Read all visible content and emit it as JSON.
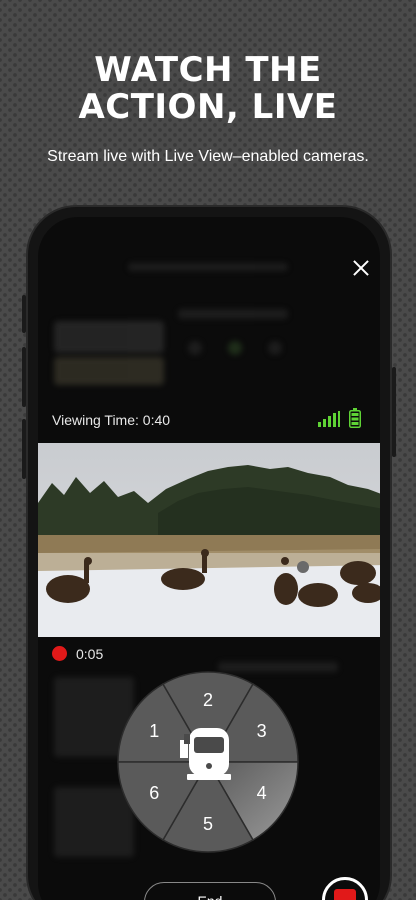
{
  "promo": {
    "headline_line1": "WATCH THE",
    "headline_line2": "ACTION, LIVE",
    "subline": "Stream live with Live View–enabled cameras."
  },
  "live_view": {
    "viewing_time": "Viewing Time: 0:40",
    "recording_time": "0:05",
    "end_label": "End",
    "signal_color": "#5fd335",
    "battery_color": "#5fd335",
    "record_color": "#e11919"
  },
  "pan_control": {
    "segments": [
      {
        "label": "1",
        "icon": "camera-position-1"
      },
      {
        "label": "2",
        "icon": "camera-position-2"
      },
      {
        "label": "3",
        "icon": "camera-position-3"
      },
      {
        "label": "4",
        "icon": "camera-position-4",
        "selected": true
      },
      {
        "label": "5",
        "icon": "camera-position-5"
      },
      {
        "label": "6",
        "icon": "camera-position-6"
      }
    ],
    "center_icon": "trail-camera-icon"
  }
}
